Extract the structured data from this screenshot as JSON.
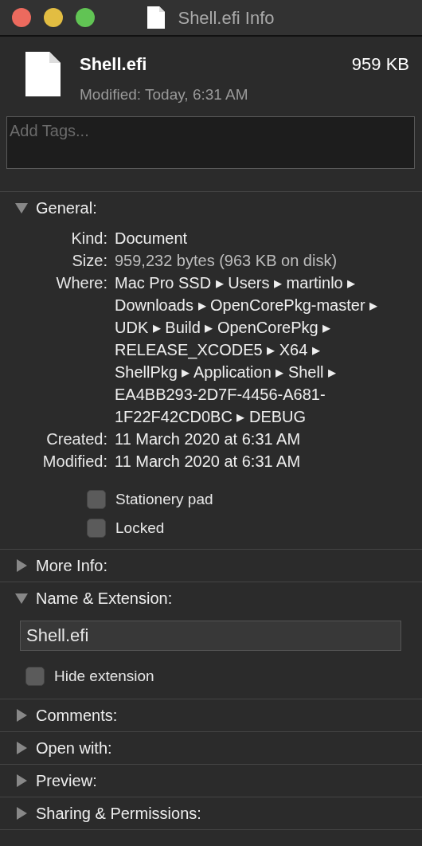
{
  "window": {
    "title": "Shell.efi Info"
  },
  "header": {
    "name": "Shell.efi",
    "size": "959 KB",
    "modified": "Modified: Today, 6:31 AM"
  },
  "tags": {
    "placeholder": "Add Tags..."
  },
  "sections": [
    {
      "kind": "general",
      "title": "General:",
      "expanded": true,
      "fields": [
        {
          "label": "Kind:",
          "value": "Document",
          "muted": false
        },
        {
          "label": "Size:",
          "value": "959,232 bytes (963 KB on disk)",
          "muted": true
        },
        {
          "label": "Where:",
          "value": "Mac Pro SSD ▸ Users ▸ martinlo ▸ Downloads ▸ OpenCorePkg-master ▸ UDK ▸ Build ▸ OpenCorePkg ▸ RELEASE_XCODE5 ▸ X64 ▸ ShellPkg ▸ Application ▸ Shell ▸ EA4BB293-2D7F-4456-A681-1F22F42CD0BC ▸ DEBUG",
          "muted": false
        },
        {
          "label": "Created:",
          "value": "11 March 2020 at 6:31 AM",
          "muted": false
        },
        {
          "label": "Modified:",
          "value": "11 March 2020 at 6:31 AM",
          "muted": false
        }
      ],
      "checkboxes": [
        {
          "label": "Stationery pad",
          "checked": false
        },
        {
          "label": "Locked",
          "checked": false
        }
      ]
    },
    {
      "kind": "plain",
      "title": "More Info:",
      "expanded": false
    },
    {
      "kind": "name",
      "title": "Name & Extension:",
      "expanded": true,
      "value": "Shell.efi",
      "checkboxes": [
        {
          "label": "Hide extension",
          "checked": false
        }
      ]
    },
    {
      "kind": "plain",
      "title": "Comments:",
      "expanded": false
    },
    {
      "kind": "plain",
      "title": "Open with:",
      "expanded": false
    },
    {
      "kind": "plain",
      "title": "Preview:",
      "expanded": false
    },
    {
      "kind": "plain",
      "title": "Sharing & Permissions:",
      "expanded": false
    }
  ]
}
